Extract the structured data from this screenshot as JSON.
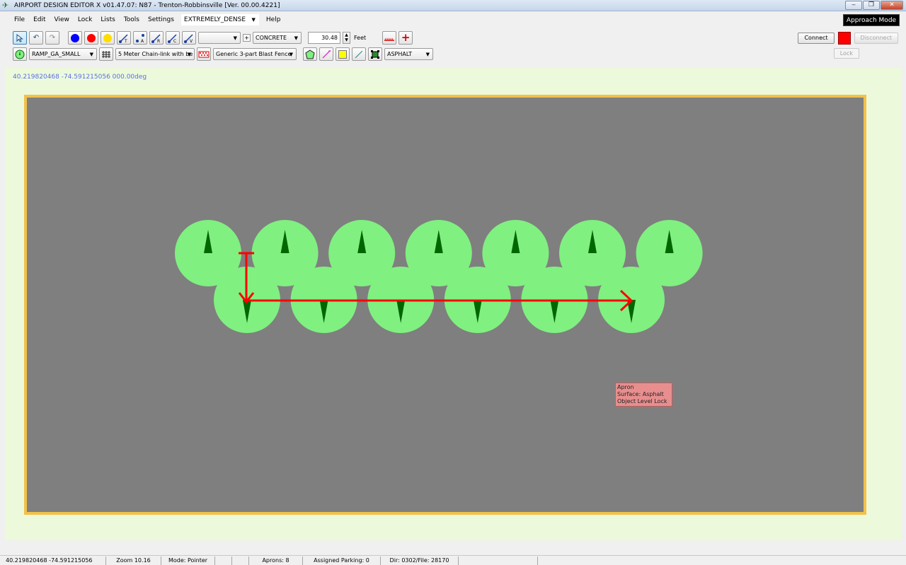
{
  "window": {
    "title": "AIRPORT DESIGN EDITOR X  v01.47.07: N87 - Trenton-Robbinsville [Ver. 00.00.4221]",
    "minimize": "‒",
    "restore": "❐",
    "close": "✕"
  },
  "menu": {
    "items": [
      "File",
      "Edit",
      "View",
      "Lock",
      "Lists",
      "Tools",
      "Settings"
    ],
    "density_value": "EXTREMELY_DENSE",
    "help": "Help",
    "approach_mode": "Approach Mode"
  },
  "toolbar1": {
    "surface_value": "CONCRETE",
    "blank_combo_value": "",
    "plus_small": "+",
    "width_value": "30.48",
    "width_unit": "Feet",
    "node_letters": [
      "T",
      "A",
      "R",
      "C",
      "V"
    ],
    "colors": {
      "blue": "#0000ff",
      "red": "#ff0000",
      "yellow": "#ffdd00"
    }
  },
  "toolbar2": {
    "parking_type": "RAMP_GA_SMALL",
    "fence_type": "5 Meter Chain-link with be",
    "blast_fence": "Generic 3-part Blast Fence",
    "surface2": "ASPHALT"
  },
  "connection": {
    "connect": "Connect",
    "disconnect": "Disconnect",
    "lock": "Lock",
    "status_color": "#ff0000"
  },
  "map": {
    "coordinates": "40.219820468   -74.591215056 000.00deg",
    "parking_count_top": 7,
    "parking_count_bottom": 6,
    "tooltip": {
      "line1": "Apron",
      "line2": "Surface: Asphalt",
      "line3": "Object Level Lock"
    },
    "colors": {
      "apron": "#7f7f7f",
      "spot": "#80f080",
      "marker": "#006600",
      "arrow": "#ff0000",
      "border": "#f2c14a"
    }
  },
  "status": {
    "position": "40.219820468  -74.591215056",
    "zoom": "Zoom 10.16",
    "mode": "Mode: Pointer",
    "blank1": "",
    "blank2": "",
    "aprons": "Aprons: 8",
    "assigned": "Assigned Parking: 0",
    "dir": "Dir: 0302/File: 28170"
  }
}
